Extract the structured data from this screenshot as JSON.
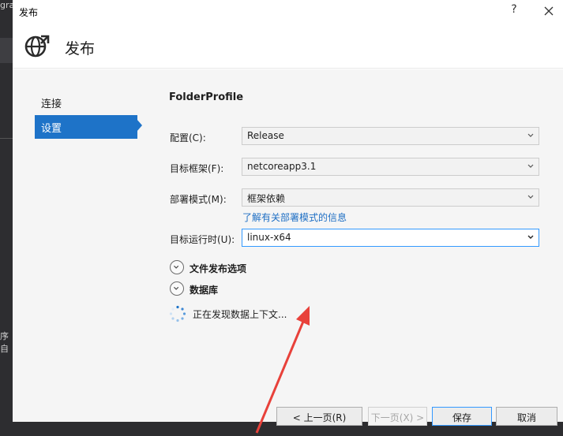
{
  "background": {
    "left_text_top": "gra",
    "left_text_bottom": "序自"
  },
  "window": {
    "title": "发布",
    "help_label": "?",
    "close_label": "×"
  },
  "header": {
    "title": "发布",
    "icon": "globe-publish-icon"
  },
  "nav": {
    "items": [
      {
        "label": "连接"
      },
      {
        "label": "设置"
      }
    ],
    "active_index": 1
  },
  "profile": {
    "title": "FolderProfile"
  },
  "fields": {
    "configuration": {
      "label": "配置(C):",
      "value": "Release"
    },
    "target_framework": {
      "label": "目标框架(F):",
      "value": "netcoreapp3.1"
    },
    "deployment_mode": {
      "label": "部署模式(M):",
      "value": "框架依赖"
    },
    "deployment_link": "了解有关部署模式的信息",
    "target_runtime": {
      "label": "目标运行时(U):",
      "value": "linux-x64"
    }
  },
  "expanders": {
    "file_publish": "文件发布选项",
    "database": "数据库"
  },
  "status": {
    "loading_text": "正在发现数据上下文..."
  },
  "buttons": {
    "prev": "< 上一页(R)",
    "next": "下一页(X) >",
    "save": "保存",
    "cancel": "取消"
  },
  "colors": {
    "accent": "#1e73c8",
    "link": "#1f6fc4",
    "annotation_arrow": "#e8413a"
  }
}
